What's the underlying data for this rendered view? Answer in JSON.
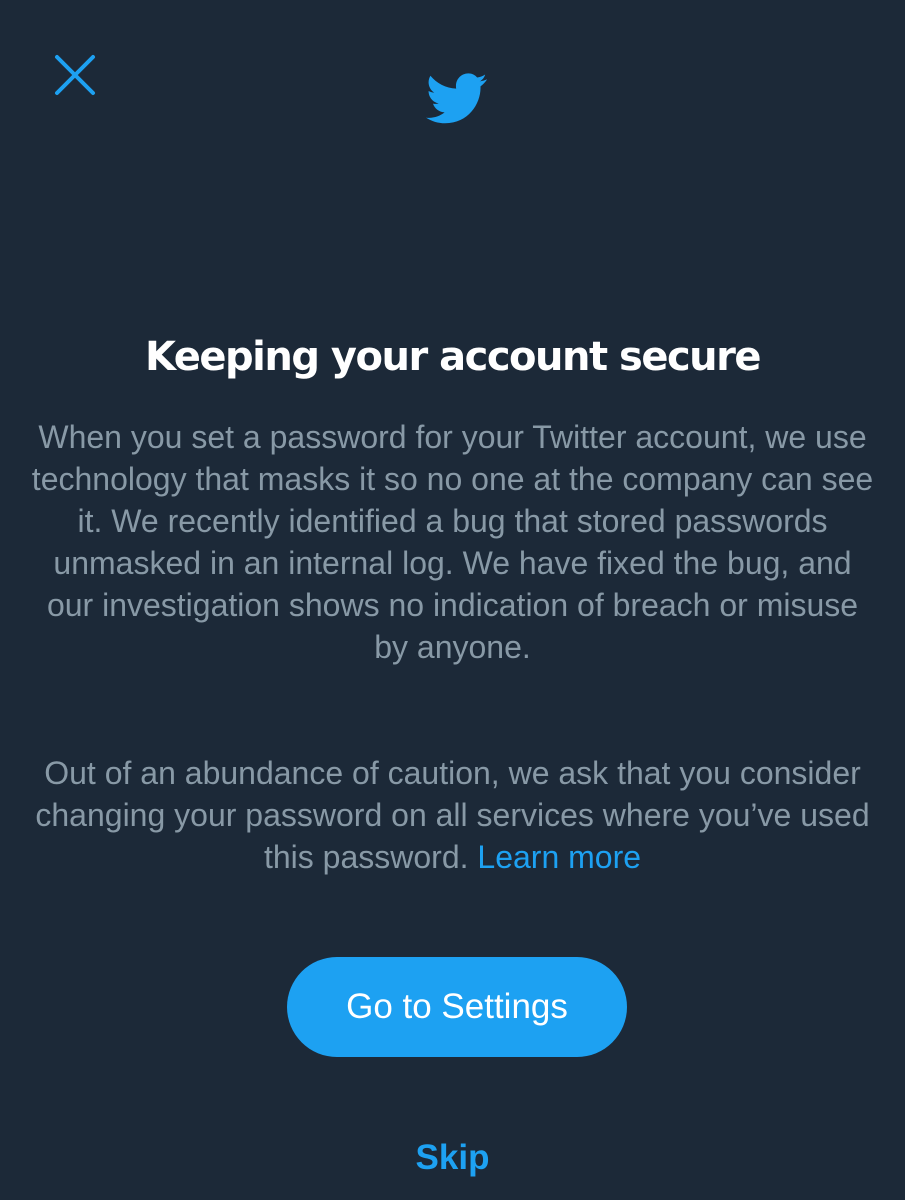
{
  "colors": {
    "background": "#1c2938",
    "accent": "#1da1f2",
    "body_text": "#8899a6",
    "title_text": "#ffffff"
  },
  "icons": {
    "close": "close-icon",
    "logo": "twitter-bird-icon"
  },
  "dialog": {
    "title": "Keeping your account secure",
    "paragraph1": "When you set a password for your Twitter account, we use technology that masks it so no one at the company can see it. We recently identified a bug that stored passwords unmasked in an internal log. We have fixed the bug, and our investigation shows no indication of breach or misuse by anyone.",
    "paragraph2_text": "Out of an abundance of caution, we ask that you consider changing your password on all services where you’ve used this password.",
    "learn_more_label": "Learn more",
    "primary_button_label": "Go to Settings",
    "skip_label": "Skip"
  }
}
